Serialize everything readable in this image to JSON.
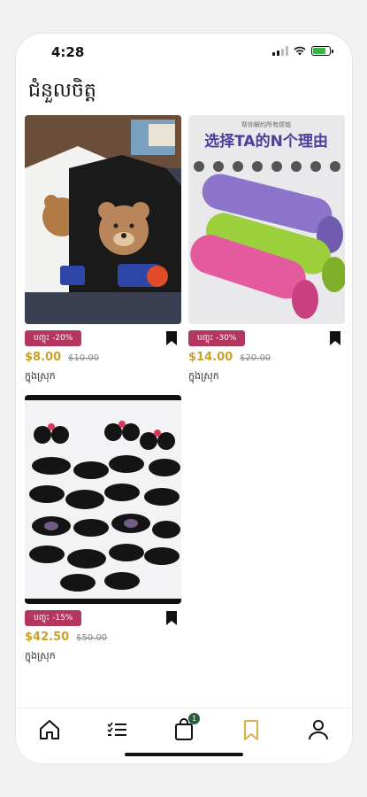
{
  "status_bar": {
    "time": "4:28",
    "battery_color": "#39b54a"
  },
  "page": {
    "title": "ជំនួលចិត្ត"
  },
  "products": [
    {
      "image_desc": "bear-tshirts",
      "discount": "បញ្ចុះ -20%",
      "price": "$8.00",
      "old_price": "$10.00",
      "shop": "ក្នុងស្រុក"
    },
    {
      "image_desc": "yoga-mats",
      "discount": "បញ្ចុះ -30%",
      "price": "$14.00",
      "old_price": "$20.00",
      "shop": "ក្នុងស្រុក",
      "image_text_small": "帮你解约所有烦恼",
      "image_text_large": "选择TA的N个理由"
    },
    {
      "image_desc": "sunglasses",
      "discount": "បញ្ចុះ -15%",
      "price": "$42.50",
      "old_price": "$50.00",
      "shop": "ក្នុងស្រុក"
    }
  ],
  "tab_bar": {
    "tabs": [
      "home-icon",
      "list-icon",
      "cart-icon",
      "bookmark-icon",
      "profile-icon"
    ],
    "active_color": "#d4b14a",
    "cart_count": "1"
  },
  "colors": {
    "badge": "#b3365e",
    "price": "#c9a227",
    "cart_badge": "#2e5b3a"
  }
}
